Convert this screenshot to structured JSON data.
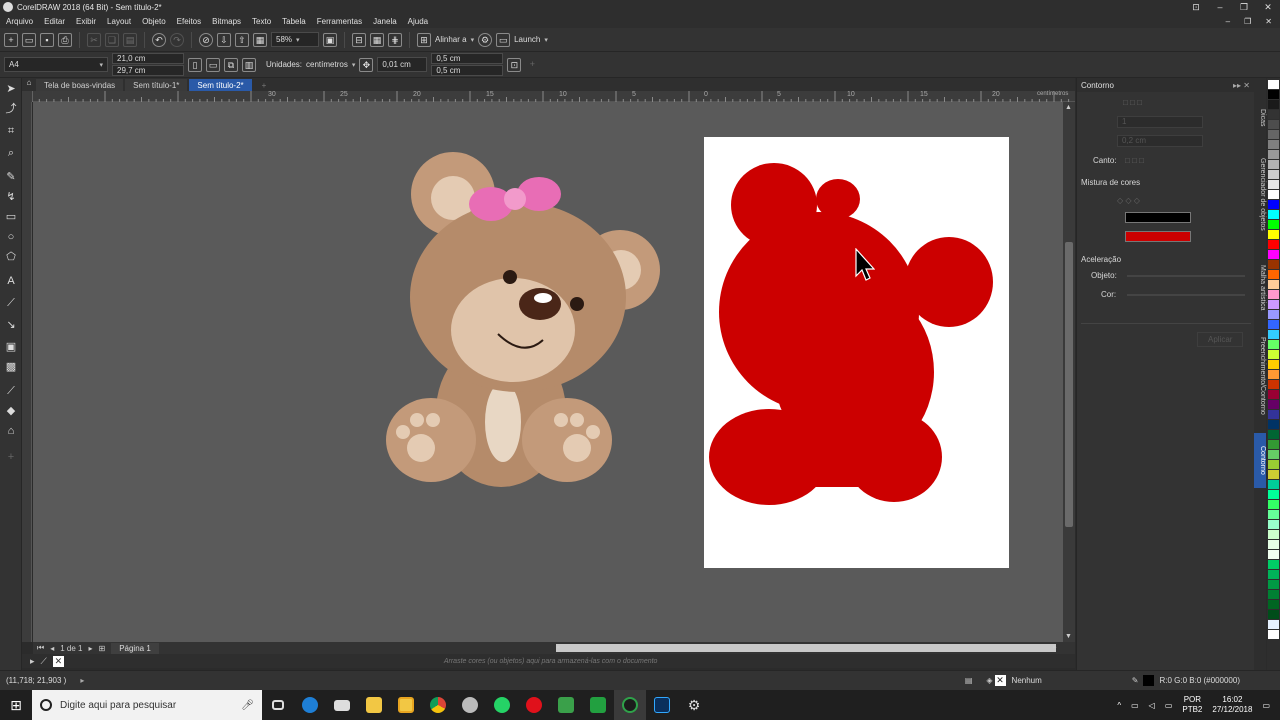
{
  "window": {
    "title": "CorelDRAW 2018 (64 Bit) - Sem título-2*"
  },
  "menu": [
    "Arquivo",
    "Editar",
    "Exibir",
    "Layout",
    "Objeto",
    "Efeitos",
    "Bitmaps",
    "Texto",
    "Tabela",
    "Ferramentas",
    "Janela",
    "Ajuda"
  ],
  "toolbar": {
    "zoom": "58%",
    "align_label": "Alinhar a",
    "launch_label": "Launch"
  },
  "propbar": {
    "page_size": "A4",
    "width": "21,0 cm",
    "height": "29,7 cm",
    "units_label": "Unidades:",
    "units_value": "centímetros",
    "nudge": "0,01 cm",
    "dup_x": "0,5 cm",
    "dup_y": "0,5 cm"
  },
  "doc_tabs": [
    "Tela de boas-vindas",
    "Sem título-1*",
    "Sem título-2*"
  ],
  "ruler": {
    "h_ticks": [
      "30",
      "25",
      "20",
      "15",
      "10",
      "5",
      "0",
      "5",
      "10",
      "15",
      "20"
    ],
    "unit": "centímetros"
  },
  "docker": {
    "title": "Contorno",
    "field1": "1",
    "field2": "0,2 cm",
    "corners_label": "Canto:",
    "blend_label": "Mistura de cores",
    "accel_label": "Aceleração",
    "object_label": "Objeto:",
    "color_label": "Cor:",
    "apply_label": "Aplicar",
    "color_black": "#000000",
    "color_red": "#cc0000"
  },
  "vtabs": [
    "Dicas",
    "Gerenciador de objetos",
    "Malha artística",
    "Preenchimento/Contorno",
    "Contorno"
  ],
  "page_nav": {
    "counter": "1 de 1",
    "page_tab": "Página 1"
  },
  "palette_hint": "Arraste cores (ou objetos) aqui para armazená-las com o documento",
  "status": {
    "coords": "(11,718; 21,903 )",
    "fill_label": "Nenhum",
    "color_info": "R:0 G:0 B:0 (#000000)"
  },
  "taskbar": {
    "search_placeholder": "Digite aqui para pesquisar",
    "lang": "POR",
    "lang2": "PTB2",
    "time": "16:02",
    "date": "27/12/2018"
  },
  "colors": {
    "shape_red": "#cc0000",
    "bear_brown": "#b58b6a",
    "bow_pink": "#e86db5",
    "accent_blue": "#2a5aa8"
  }
}
